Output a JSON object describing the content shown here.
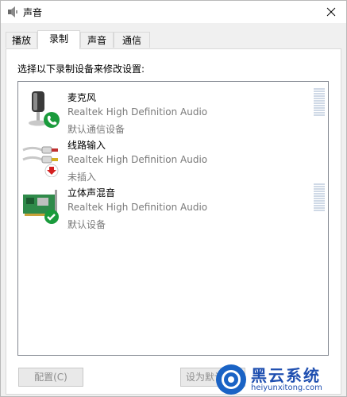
{
  "window": {
    "title": "声音"
  },
  "tabs": [
    {
      "label": "播放",
      "active": false
    },
    {
      "label": "录制",
      "active": true
    },
    {
      "label": "声音",
      "active": false
    },
    {
      "label": "通信",
      "active": false
    }
  ],
  "panel": {
    "instruction": "选择以下录制设备来修改设置:"
  },
  "devices": [
    {
      "name": "麦克风",
      "driver": "Realtek High Definition Audio",
      "status": "默认通信设备",
      "icon": "microphone-icon",
      "badge": "phone-badge-icon",
      "badge_color": "#1a9b3c"
    },
    {
      "name": "线路输入",
      "driver": "Realtek High Definition Audio",
      "status": "未插入",
      "icon": "line-in-cable-icon",
      "badge": "unplugged-arrow-icon",
      "badge_color": "#d42020"
    },
    {
      "name": "立体声混音",
      "driver": "Realtek High Definition Audio",
      "status": "默认设备",
      "icon": "sound-card-icon",
      "badge": "checkmark-badge-icon",
      "badge_color": "#1a9b3c"
    }
  ],
  "buttons": {
    "configure": "配置(C)",
    "set_default": "设为默认"
  },
  "watermark": {
    "title": "黑云系统",
    "url": "heiyunxitong.com"
  },
  "colors": {
    "accent": "#1a63c5",
    "ok": "#1a9b3c",
    "error": "#d42020"
  }
}
